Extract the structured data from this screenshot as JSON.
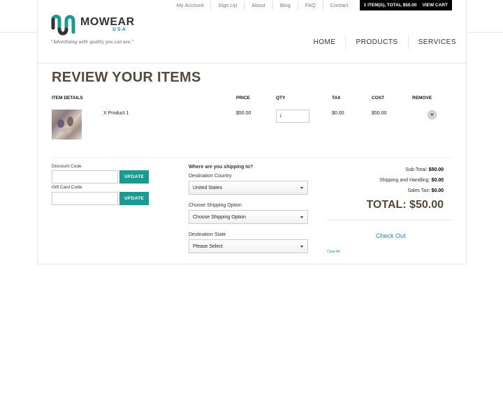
{
  "util_nav": {
    "my_account": "My Account",
    "sign_up": "Sign Up",
    "about": "About",
    "blog": "Blog",
    "faq": "FAQ",
    "contact": "Contact",
    "cart_summary": "1 ITEM(S), TOTAL $50.00",
    "view_cart": "VIEW CART"
  },
  "logo": {
    "word": "MOWEAR",
    "sub": "USA",
    "tagline": "\"Advertising with quality you can see.\""
  },
  "main_nav": [
    "HOME",
    "PRODUCTS",
    "SERVICES"
  ],
  "page_title": "REVIEW YOUR ITEMS",
  "table": {
    "headers": {
      "details": "ITEM DETAILS",
      "price": "PRICE",
      "qty": "QTY",
      "tax": "TAX",
      "cost": "COST",
      "remove": "REMOVE"
    },
    "rows": [
      {
        "name": "X Product 1",
        "price": "$50.00",
        "qty": "1",
        "tax": "$0.00",
        "cost": "$50.00"
      }
    ]
  },
  "discount": {
    "discount_label": "Discount Code",
    "giftcard_label": "Gift Card Code",
    "update_label": "UPDATE"
  },
  "shipping": {
    "title": "Where are you shipping to?",
    "country_label": "Destination Country",
    "country_value": "United States",
    "option_label": "Choose Shipping Option",
    "option_value": "Choose Shipping Option",
    "state_label": "Destination State",
    "state_value": "Please Select"
  },
  "totals": {
    "subtotal_label": "Sub-Total:",
    "subtotal_value": "$50.00",
    "shipping_label": "Shipping and Handling:",
    "shipping_value": "$0.00",
    "tax_label": "Sales Tax:",
    "tax_value": "$0.00",
    "grand_total": "TOTAL: $50.00",
    "checkout": "Check Out",
    "clear_all": "Clear All"
  },
  "colors": {
    "accent": "#1a9a93",
    "link": "#1a8bc8",
    "title": "#55493d"
  }
}
